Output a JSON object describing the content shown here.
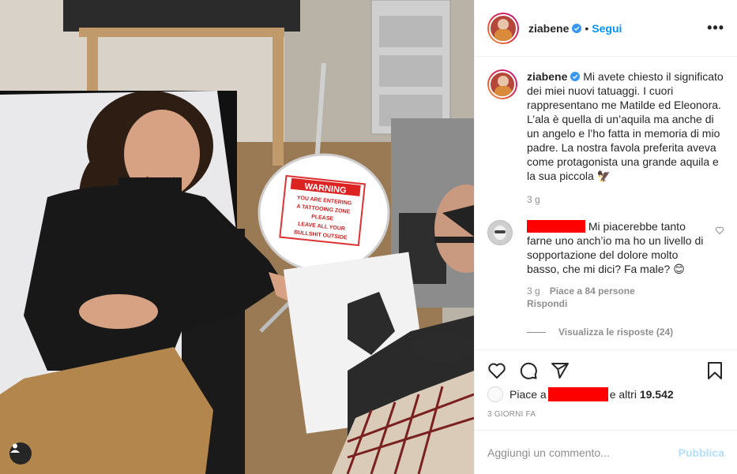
{
  "post": {
    "username": "ziabene",
    "separator": "•",
    "follow_label": "Segui",
    "more_label": "•••"
  },
  "caption": {
    "username": "ziabene",
    "text": "Mi avete chiesto il significato dei miei nuovi tatuaggi. I cuori rappresentano me Matilde ed Eleonora. L’ala è quella di un’aquila ma anche di un angelo e l’ho fatta in memoria di mio padre. La nostra favola preferita aveva come protagonista una grande aquila e la sua piccola 🦅",
    "time": "3 g"
  },
  "comment": {
    "text": "Mi piacerebbe tanto farne uno anch’io ma ho un livello di sopportazione del dolore molto basso, che mi dici? Fa male? 😊",
    "time": "3 g",
    "likes": "Piace a 84 persone",
    "reply_label": "Rispondi",
    "view_replies": "Visualizza le risposte (24)"
  },
  "likes": {
    "prefix": "Piace a",
    "suffix": "e altri",
    "count": "19.542"
  },
  "date": "3 GIORNI FA",
  "add_comment": {
    "placeholder": "Aggiungi un commento...",
    "publish_label": "Pubblica"
  },
  "photo": {
    "sign_title": "WARNING",
    "sign_lines": [
      "YOU ARE ENTERING",
      "A TATTOOING ZONE",
      "PLEASE",
      "LEAVE ALL YOUR",
      "BULLSHIT OUTSIDE"
    ]
  },
  "colors": {
    "accent": "#0095f6",
    "publish_disabled": "#b2dffc",
    "redaction": "#ff0000",
    "verified": "#3897f0"
  },
  "icons": [
    "heart-icon",
    "comment-icon",
    "share-icon",
    "bookmark-icon",
    "user-tag-icon",
    "verified-badge-icon"
  ]
}
